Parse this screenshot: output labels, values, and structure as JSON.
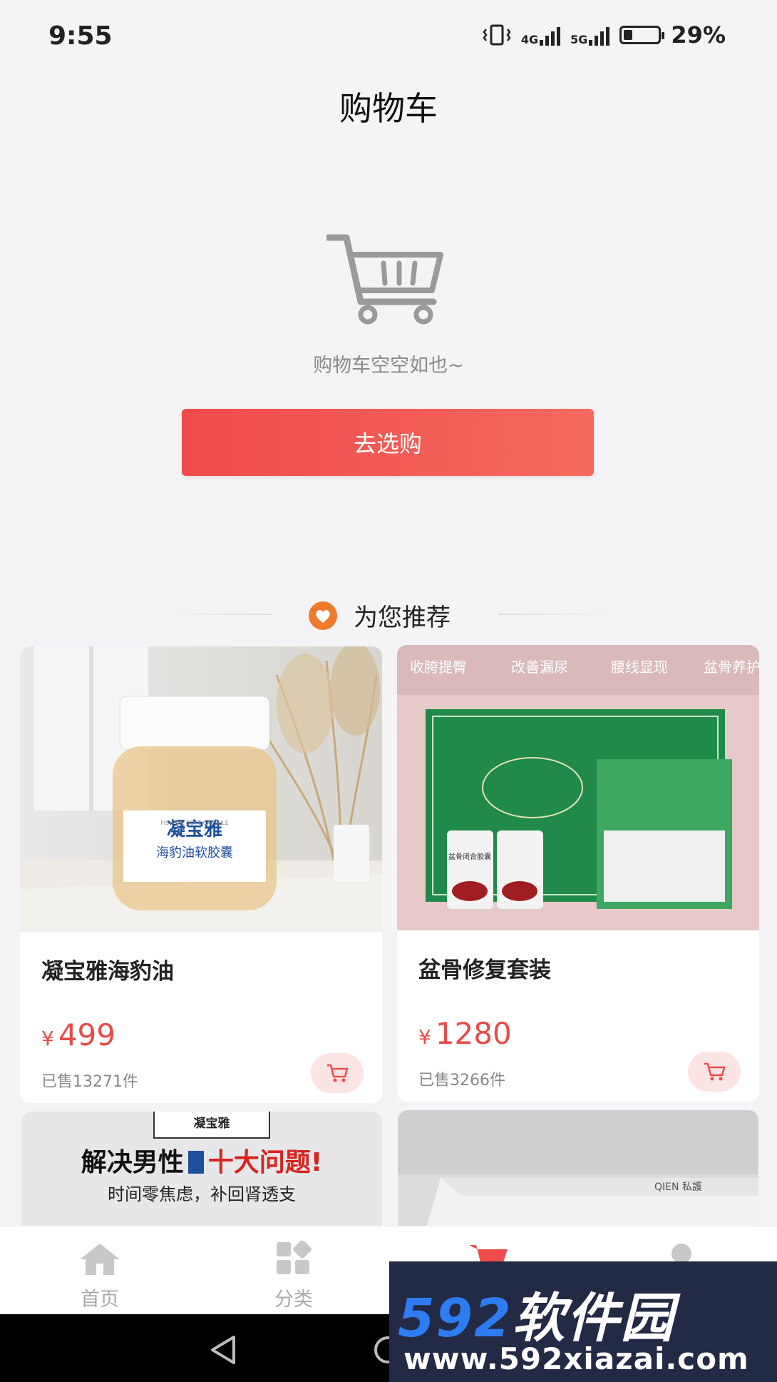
{
  "status_bar": {
    "time": "9:55",
    "network_1": "4G",
    "network_2": "5G",
    "battery": "29%"
  },
  "header": {
    "title": "购物车"
  },
  "empty_cart": {
    "message": "购物车空空如也~",
    "button_label": "去选购"
  },
  "recommend": {
    "title": "为您推荐"
  },
  "products": [
    {
      "name": "凝宝雅海豹油",
      "currency": "¥",
      "price": "499",
      "sold": "已售13271件",
      "image_text": {
        "brand": "凝宝雅",
        "product": "海豹油软胶囊",
        "sub": "FISH OIL SOFT CAPSULE"
      }
    },
    {
      "name": "盆骨修复套装",
      "currency": "¥",
      "price": "1280",
      "sold": "已售3266件",
      "image_text": {
        "tags": [
          "收胯提臀",
          "改善漏尿",
          "腰线显现",
          "盆骨养护"
        ],
        "bottle_label": "盆骨闭合胶囊"
      }
    },
    {
      "image_text": {
        "brand": "凝宝雅",
        "headline_a": "解决男性",
        "headline_b": "十大问题!",
        "sub": "时间零焦虑，补回肾透支"
      }
    },
    {
      "image_text": {
        "box_label": "QIEN 私護"
      }
    }
  ],
  "bottom_nav": {
    "items": [
      {
        "label": "首页"
      },
      {
        "label": "分类"
      }
    ]
  },
  "watermark": {
    "numbers": "592",
    "name": "软件园",
    "url": "www.592xiazai.com"
  },
  "colors": {
    "accent": "#ef4b4b",
    "price": "#e84a4a",
    "heart": "#ef7a2a"
  }
}
